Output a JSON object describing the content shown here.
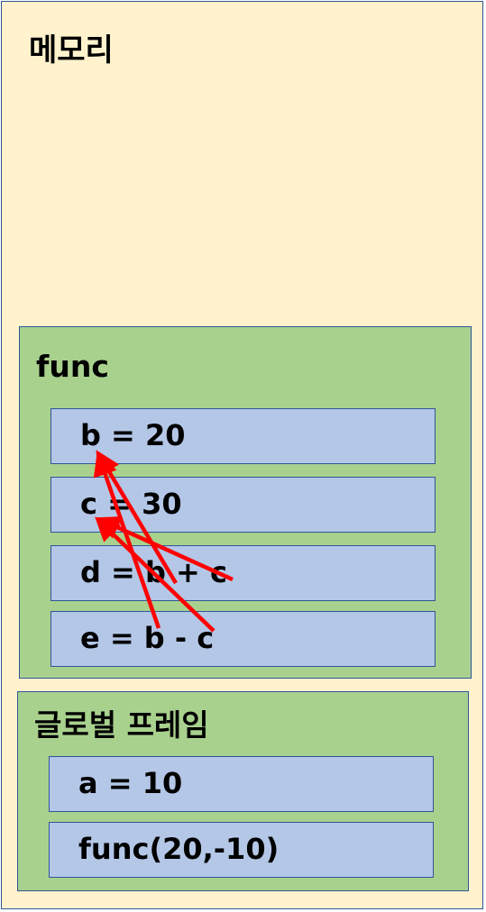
{
  "memory": {
    "title": "메모리"
  },
  "func_frame": {
    "title": "func",
    "vars": [
      "b = 20",
      "c = 30",
      "d = b + c",
      "e = b - c"
    ]
  },
  "global_frame": {
    "title": "글로벌 프레임",
    "vars": [
      "a = 10",
      "func(20,-10)"
    ]
  },
  "colors": {
    "memory_bg": "#fff2cc",
    "frame_bg": "#a9d18e",
    "var_bg": "#b4c7e7",
    "border": "#2f5597",
    "arrow": "#ff0000"
  }
}
